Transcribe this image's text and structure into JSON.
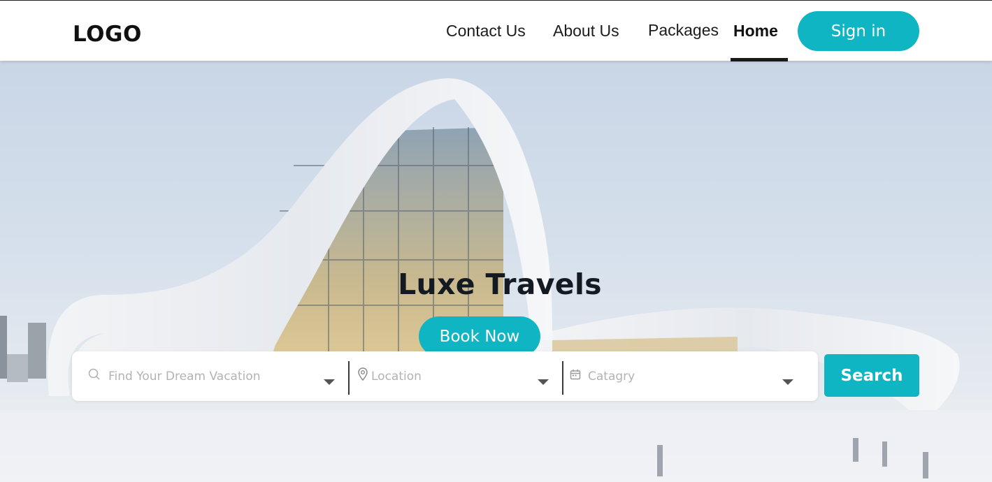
{
  "header": {
    "logo": "LOGO",
    "nav": {
      "contact": "Contact Us",
      "about": "About Us",
      "packages": "Packages",
      "home": "Home"
    },
    "signin_label": "Sign in"
  },
  "hero": {
    "title": "Luxe Travels",
    "book_label": "Book Now"
  },
  "search": {
    "dream_placeholder": "Find Your Dream Vacation",
    "location_placeholder": "Location",
    "category_placeholder": "Catagry",
    "button_label": "Search",
    "icons": [
      "search-icon",
      "location-pin-icon",
      "calendar-icon",
      "chevron-down-icon"
    ]
  },
  "colors": {
    "accent": "#0fb5c3",
    "text_dark": "#141a22"
  }
}
